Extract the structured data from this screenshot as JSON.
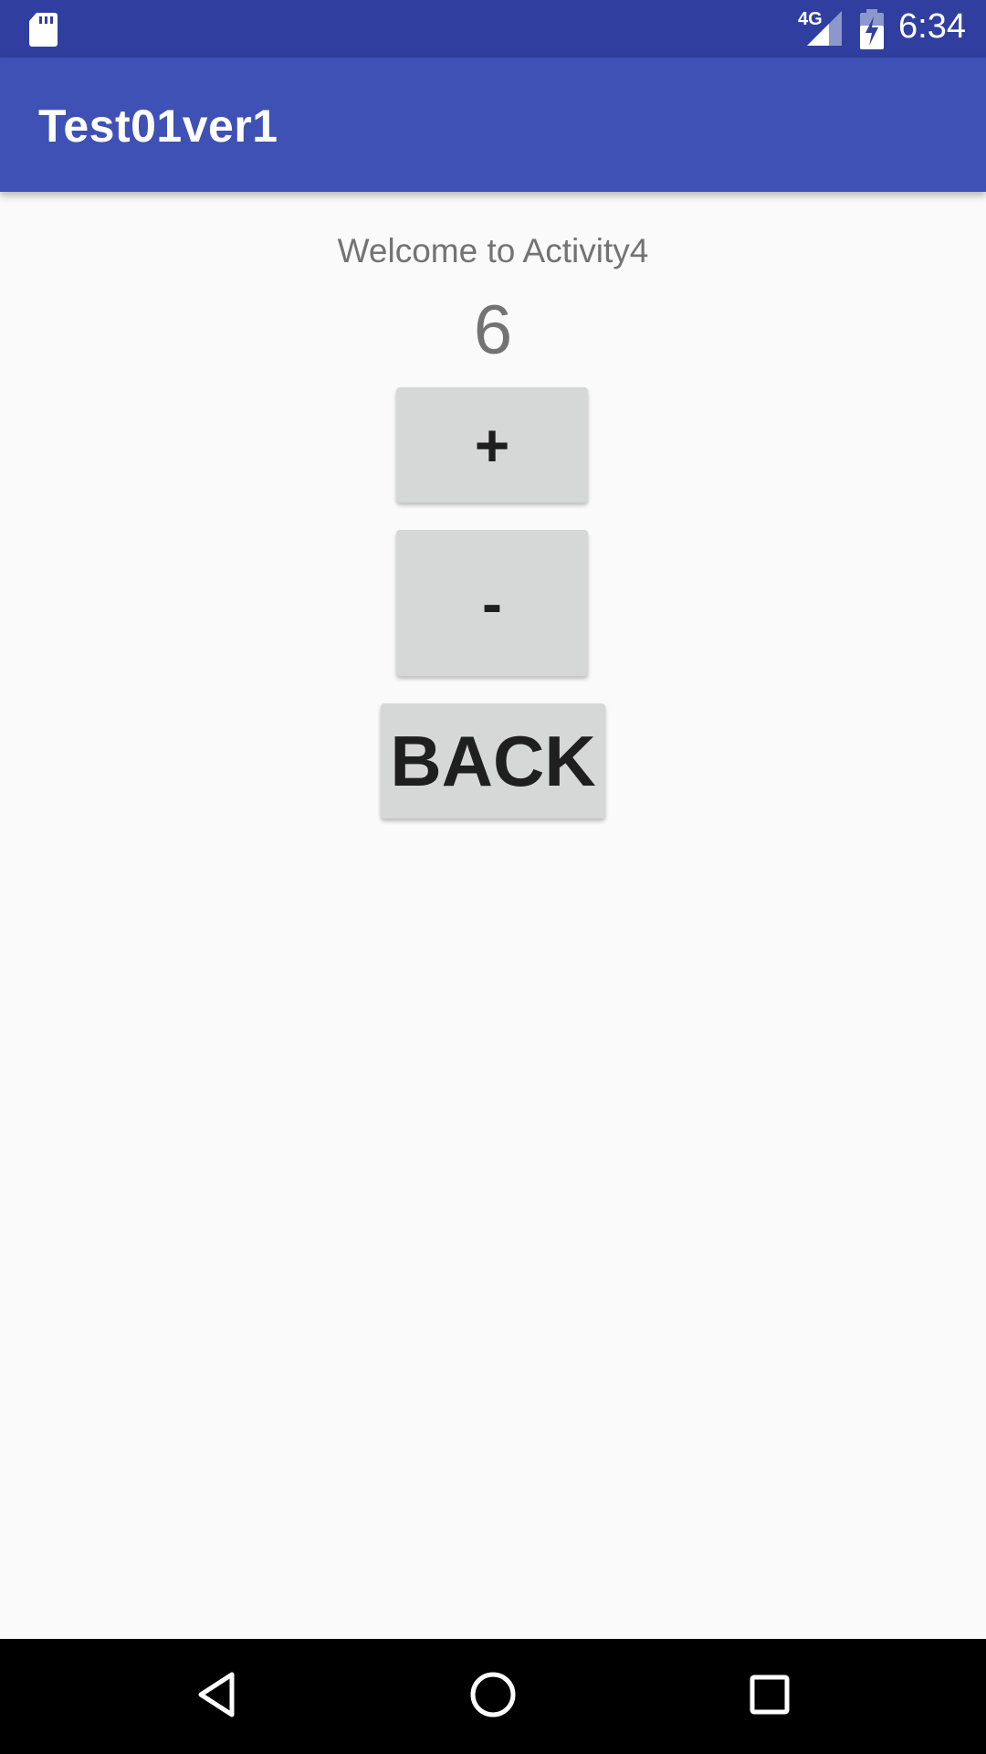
{
  "status_bar": {
    "network": "4G",
    "time": "6:34",
    "icons": [
      "sd-card-icon",
      "signal-icon",
      "battery-charging-icon"
    ]
  },
  "app_bar": {
    "title": "Test01ver1"
  },
  "main": {
    "welcome_text": "Welcome to Activity4",
    "counter_value": "6",
    "plus_label": "+",
    "minus_label": "-",
    "back_label": "BACK"
  },
  "nav_bar": {
    "icons": [
      "back-icon",
      "home-icon",
      "recents-icon"
    ]
  },
  "colors": {
    "primary": "#3f51b5",
    "primary_dark": "#303f9f",
    "background": "#fafafa",
    "button": "#d6d7d7",
    "text_secondary": "#737373"
  }
}
